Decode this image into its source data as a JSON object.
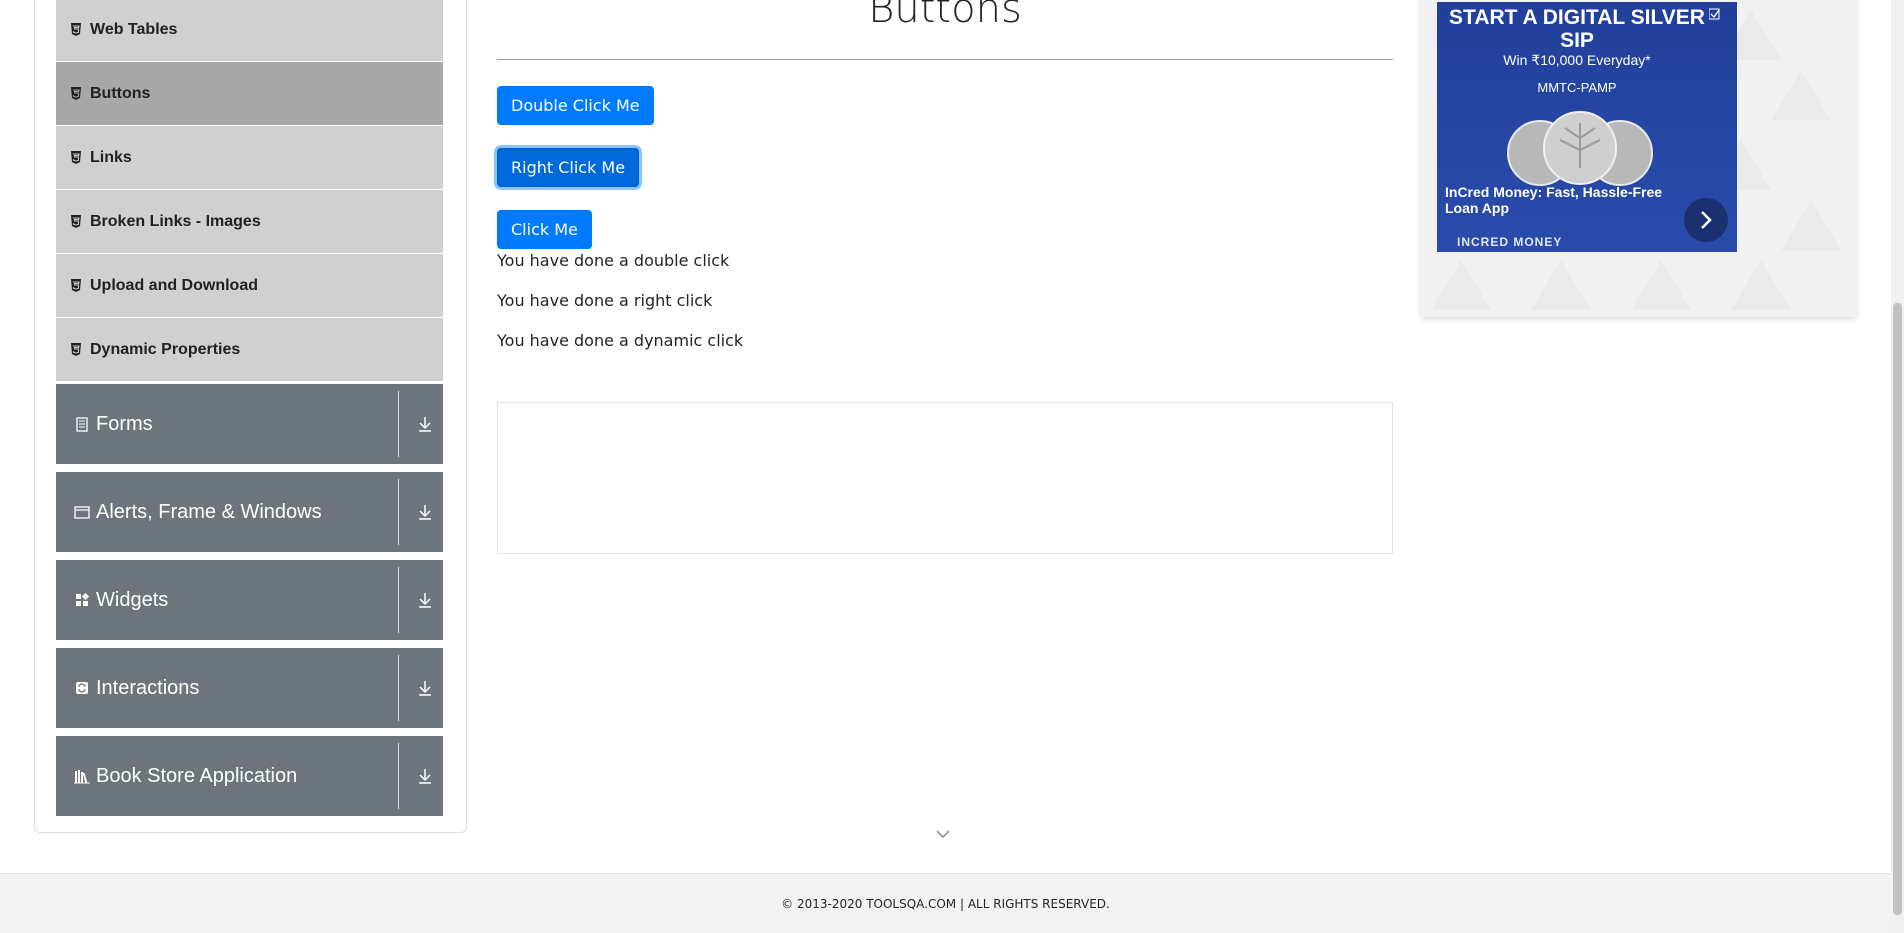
{
  "sidebar": {
    "submenu": [
      {
        "label": "Web Tables"
      },
      {
        "label": "Buttons"
      },
      {
        "label": "Links"
      },
      {
        "label": "Broken Links - Images"
      },
      {
        "label": "Upload and Download"
      },
      {
        "label": "Dynamic Properties"
      }
    ],
    "groups": [
      {
        "label": "Forms",
        "icon": "form-icon"
      },
      {
        "label": "Alerts, Frame & Windows",
        "icon": "window-icon"
      },
      {
        "label": "Widgets",
        "icon": "widgets-icon"
      },
      {
        "label": "Interactions",
        "icon": "interactions-icon"
      },
      {
        "label": "Book Store Application",
        "icon": "books-icon"
      }
    ]
  },
  "main": {
    "title": "Buttons",
    "buttons": {
      "double": "Double Click Me",
      "right": "Right Click Me",
      "click": "Click Me"
    },
    "messages": {
      "double": "You have done a double click",
      "right": "You have done a right click",
      "dynamic": "You have done a dynamic click"
    }
  },
  "ad": {
    "headline": "START A DIGITAL SILVER SIP",
    "sub": "Win ₹10,000 Everyday*",
    "brand": "MMTC-PAMP",
    "caption": "InCred Money: Fast, Hassle-Free Loan App",
    "brand2": "INCRED MONEY"
  },
  "footer": {
    "text": "© 2013-2020 TOOLSQA.COM | ALL RIGHTS RESERVED."
  },
  "colors": {
    "primary": "#007bff",
    "group_bg": "#6c757d",
    "submenu_bg": "#d0d0d0",
    "submenu_active": "#a8a8a8"
  }
}
